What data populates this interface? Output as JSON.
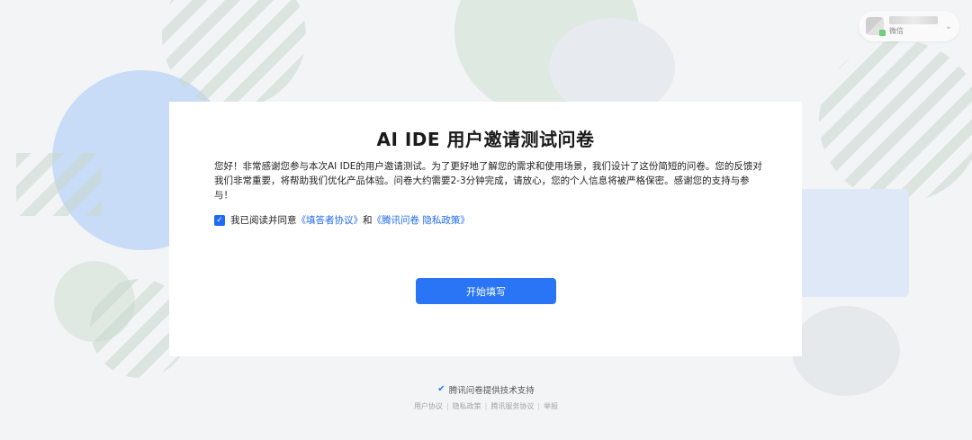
{
  "user": {
    "platform": "微信",
    "avatar_icon": "user-avatar",
    "chevron_icon": "chevron-down-icon"
  },
  "survey": {
    "title": "AI IDE 用户邀请测试问卷",
    "intro": "您好！非常感谢您参与本次AI IDE的用户邀请测试。为了更好地了解您的需求和使用场景，我们设计了这份简短的问卷。您的反馈对我们非常重要，将帮助我们优化产品体验。问卷大约需要2-3分钟完成，请放心，您的个人信息将被严格保密。感谢您的支持与参与！",
    "agreement": {
      "checked": true,
      "prefix": "我已阅读并同意",
      "link1": "《填答者协议》",
      "conjunction": "和",
      "link2": "《腾讯问卷 隐私政策》"
    },
    "start_button": "开始填写"
  },
  "footer": {
    "powered_by": "腾讯问卷提供技术支持",
    "links": [
      "用户协议",
      "隐私政策",
      "腾讯服务协议",
      "举报"
    ]
  },
  "colors": {
    "accent": "#2a75f6",
    "link": "#1f6bf2",
    "background": "#f3f4f6",
    "card": "#ffffff"
  }
}
